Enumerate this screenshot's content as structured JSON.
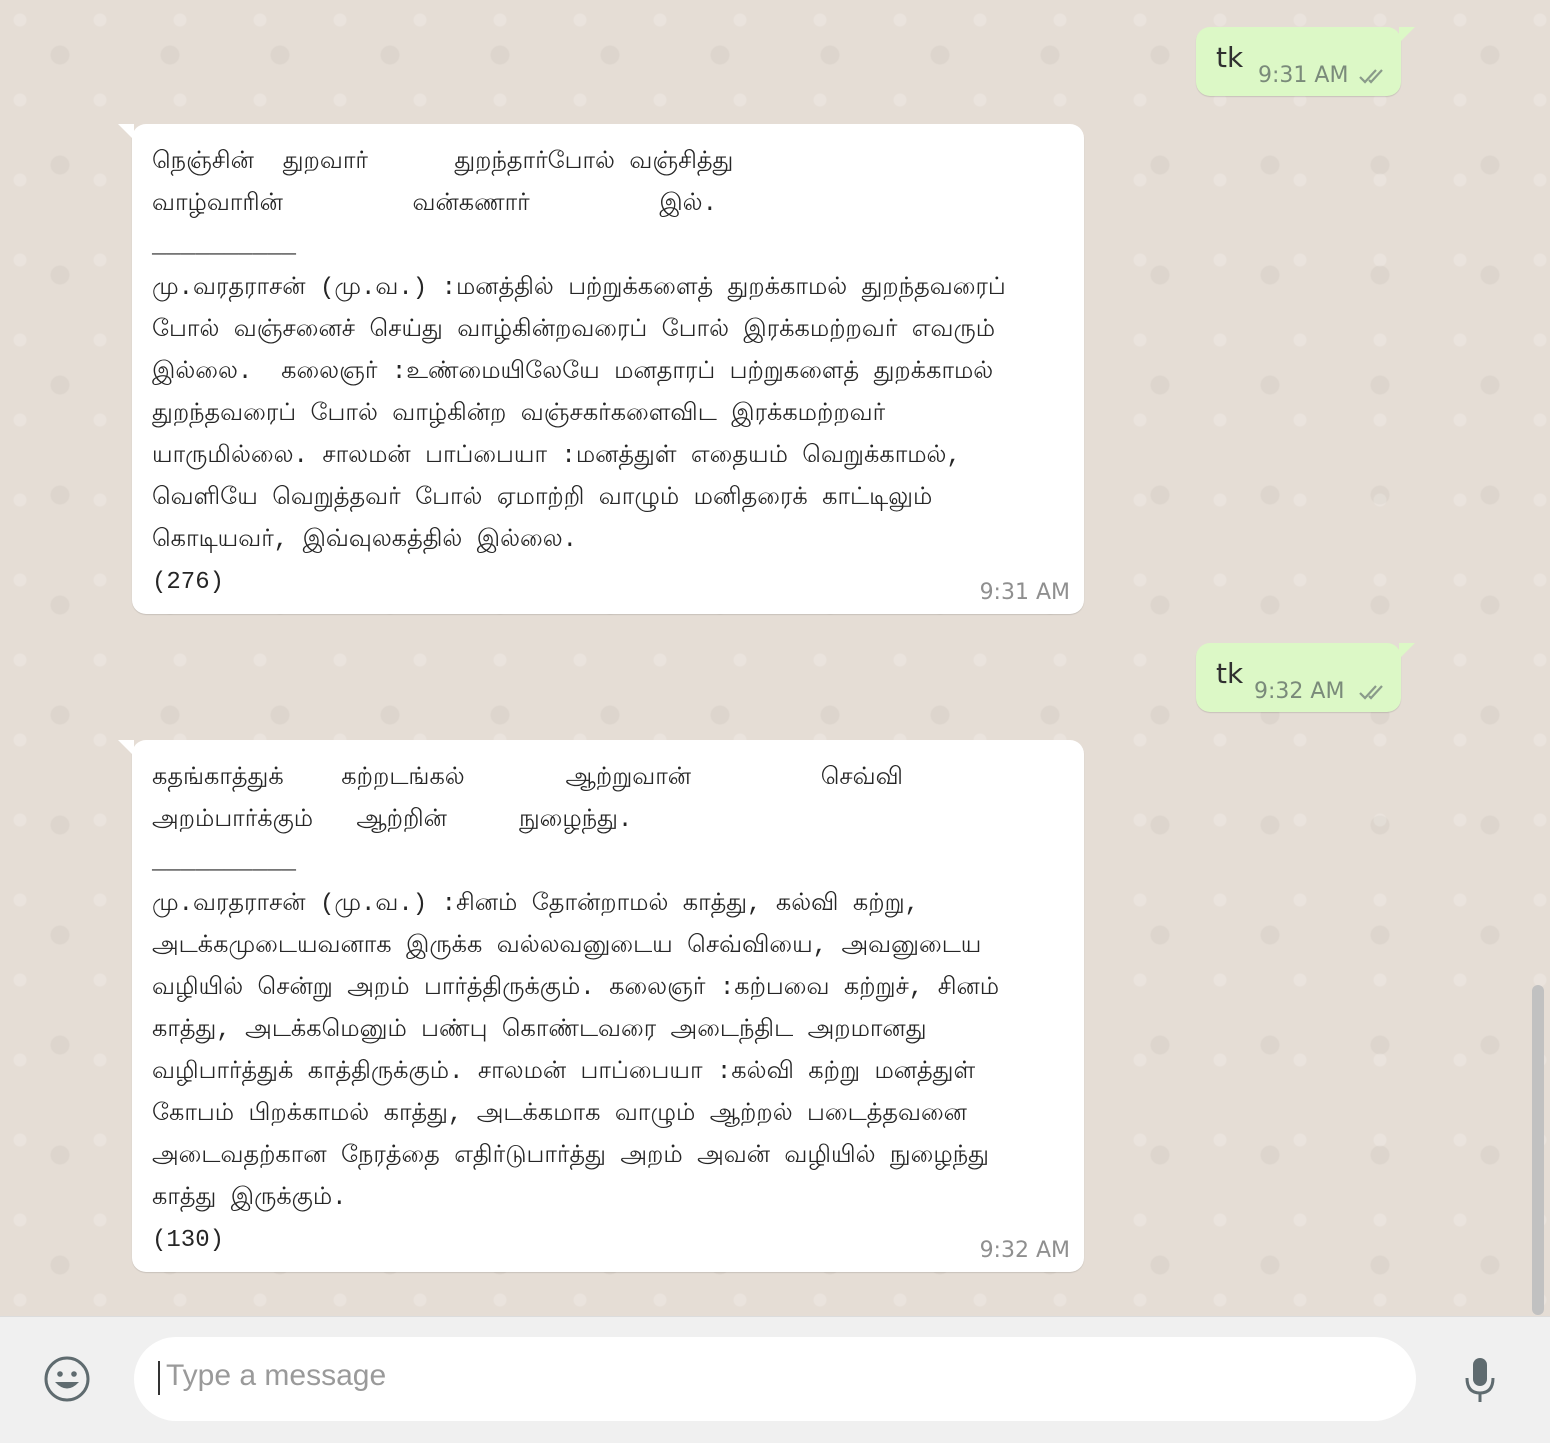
{
  "messages": [
    {
      "direction": "outgoing",
      "text": "tk",
      "time": "9:31 AM",
      "status": "read"
    },
    {
      "direction": "incoming",
      "text": "நெஞ்சின்  துறவார்      துறந்தார்போல் வஞ்சித்து\nவாழ்வாரின்         வன்கணார்         இல்.\n__________\nமு.வரதராசன் (மு.வ.) :மனத்தில் பற்றுக்களைத் துறக்காமல் துறந்தவரைப்\nபோல் வஞ்சனைச் செய்து வாழ்கின்றவரைப் போல் இரக்கமற்றவர் எவரும்\nஇல்லை.  கலைஞர் :உண்மையிலேயே மனதாரப் பற்றுகளைத் துறக்காமல்\nதுறந்தவரைப் போல் வாழ்கின்ற வஞ்சகர்களைவிட இரக்கமற்றவர்\nயாருமில்லை. சாலமன் பாப்பையா :மனத்துள் எதையம் வெறுக்காமல்,\nவெளியே வெறுத்தவர் போல் ஏமாற்றி வாழும் மனிதரைக் காட்டிலும்\nகொடியவர், இவ்வுலகத்தில் இல்லை.\n(276)",
      "time": "9:31 AM"
    },
    {
      "direction": "outgoing",
      "text": "tk",
      "time": "9:32 AM",
      "status": "read"
    },
    {
      "direction": "incoming",
      "text": "கதங்காத்துக்    கற்றடங்கல்       ஆற்றுவான்         செவ்வி\nஅறம்பார்க்கும்   ஆற்றின்     நுழைந்து.\n__________\nமு.வரதராசன் (மு.வ.) :சினம் தோன்றாமல் காத்து, கல்வி கற்று,\nஅடக்கமுடையவனாக இருக்க வல்லவனுடைய செவ்வியை, அவனுடைய\nவழியில் சென்று அறம் பார்த்திருக்கும். கலைஞர் :கற்பவை கற்றுச், சினம்\nகாத்து, அடக்கமெனும் பண்பு கொண்டவரை அடைந்திட அறமானது\nவழிபார்த்துக் காத்திருக்கும். சாலமன் பாப்பையா :கல்வி கற்று மனத்துள்\nகோபம் பிறக்காமல் காத்து, அடக்கமாக வாழும் ஆற்றல் படைத்தவனை\nஅடைவதற்கான நேரத்தை எதிர்டுபார்த்து அறம் அவன் வழியில் நுழைந்து\nகாத்து இருக்கும்.\n(130)",
      "time": "9:32 AM"
    }
  ],
  "composer": {
    "placeholder": "Type a message",
    "emoji_icon": "smiley-face-icon",
    "mic_icon": "microphone-icon"
  },
  "colors": {
    "chat_background": "#e5ddd5",
    "outgoing_bubble": "#dcf8c6",
    "incoming_bubble": "#ffffff",
    "read_ticks": "#8a9a8a"
  }
}
